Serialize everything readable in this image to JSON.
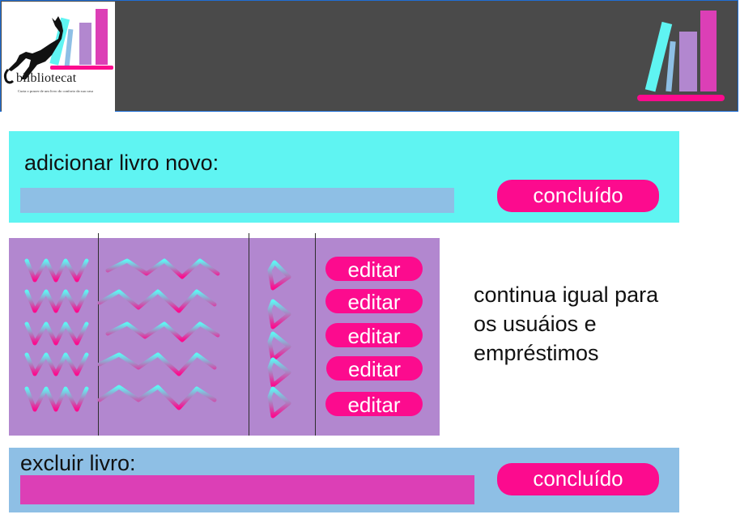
{
  "brand": {
    "name": "blibliotecat",
    "tagline": "Curta o prazer de um livro do conforto da sua casa"
  },
  "add_book": {
    "label": "adicionar livro novo:",
    "input_value": "",
    "submit_label": "concluído"
  },
  "book_table": {
    "edit_buttons": [
      "editar",
      "editar",
      "editar",
      "editar",
      "editar"
    ]
  },
  "note": {
    "lines": [
      "continua igual para",
      "os usuáios e",
      "empréstimos"
    ]
  },
  "delete_book": {
    "label": "excluir livro:",
    "input_value": "",
    "submit_label": "concluído"
  },
  "colors": {
    "header_bg": "#4a4a4a",
    "cyan": "#5ff4f2",
    "blue": "#8ebfe5",
    "purple": "#b287cf",
    "pink": "#fc0b8e",
    "magenta": "#dc3fb6"
  }
}
